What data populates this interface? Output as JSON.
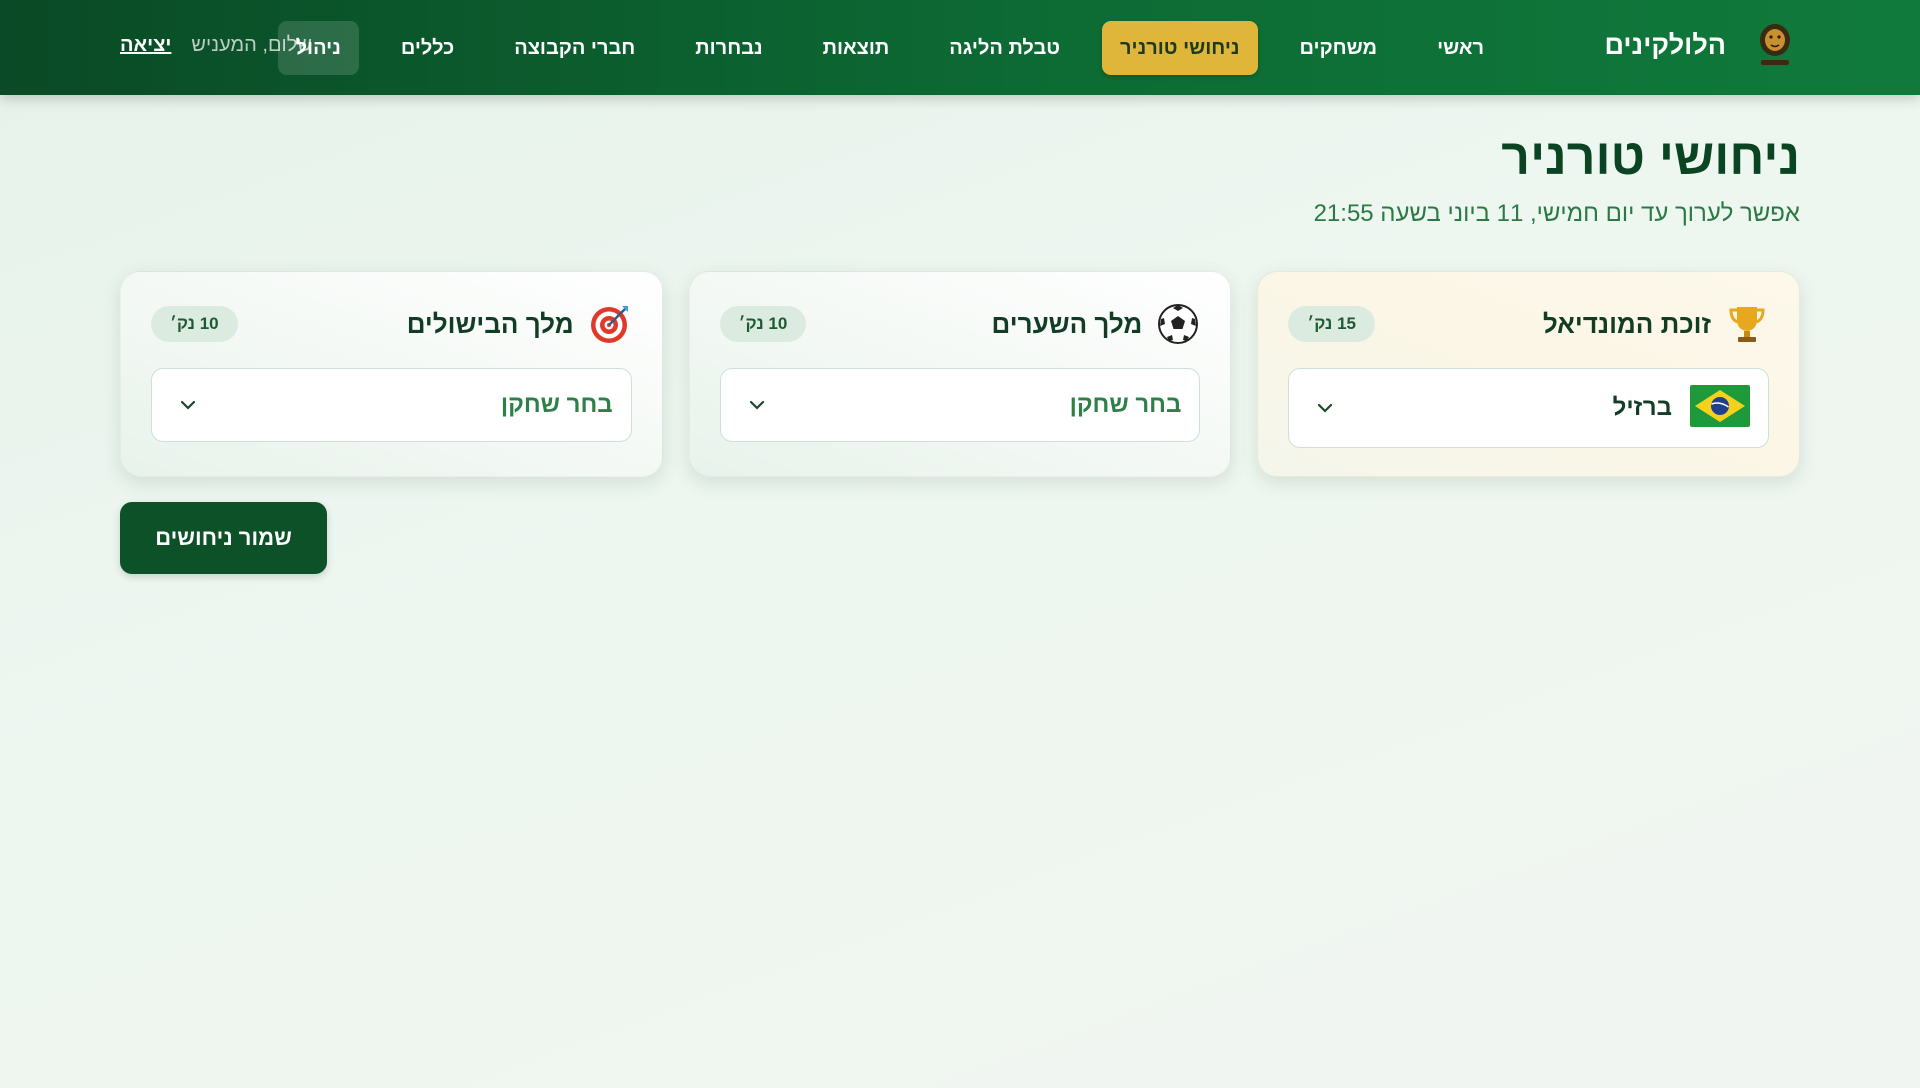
{
  "brand": {
    "name": "הלולקינים",
    "logo_icon": "lion-logo-icon"
  },
  "nav": [
    {
      "label": "ראשי",
      "active": false
    },
    {
      "label": "משחקים",
      "active": false
    },
    {
      "label": "ניחושי טורניר",
      "active": true
    },
    {
      "label": "טבלת הליגה",
      "active": false
    },
    {
      "label": "תוצאות",
      "active": false
    },
    {
      "label": "נבחרות",
      "active": false
    },
    {
      "label": "חברי הקבוצה",
      "active": false
    },
    {
      "label": "כללים",
      "active": false
    },
    {
      "label": "ניהול",
      "active": false
    }
  ],
  "user": {
    "greeting": "שלום, המעניש",
    "logout": "יציאה"
  },
  "page": {
    "title": "ניחושי טורניר",
    "subtitle": "אפשר לערוך עד יום חמישי, 11 ביוני בשעה 21:55"
  },
  "cards": [
    {
      "title": "זוכת המונדיאל",
      "icon": "trophy-icon",
      "points": "15 נק׳",
      "selected": "ברזיל",
      "selected_flag": "brazil-flag-icon"
    },
    {
      "title": "מלך השערים",
      "icon": "soccer-ball-icon",
      "points": "10 נק׳",
      "placeholder": "בחר שחקן"
    },
    {
      "title": "מלך הבישולים",
      "icon": "target-icon",
      "points": "10 נק׳",
      "placeholder": "בחר שחקן"
    }
  ],
  "actions": {
    "save_label": "שמור ניחושים"
  },
  "colors": {
    "header_dark": "#0a4a26",
    "header_light": "#107a3c",
    "accent_gold": "#e0b63a",
    "primary_button": "#0c5128",
    "title_green": "#0b4422"
  }
}
